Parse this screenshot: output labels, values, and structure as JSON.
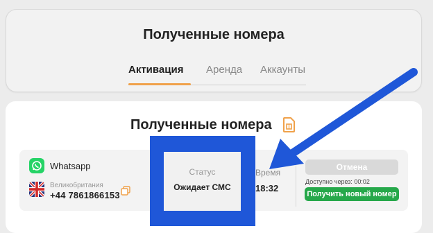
{
  "header": {
    "title": "Полученные номера",
    "tabs": [
      {
        "label": "Активация",
        "active": true
      },
      {
        "label": "Аренда",
        "active": false
      },
      {
        "label": "Аккаунты",
        "active": false
      }
    ]
  },
  "main": {
    "title": "Полученные номера",
    "row": {
      "service": "Whatsapp",
      "country": "Великобритания",
      "phone": "+44 7861866153",
      "status_label": "Статус",
      "status_value": "Ожидает СМС",
      "time_label": "Время",
      "time_value": "18:32",
      "cancel_label": "Отмена",
      "available_text": "Доступно через: 00:02",
      "new_number_label": "Получить новый номер"
    }
  },
  "colors": {
    "accent": "#f0a14a",
    "highlight": "#1f57d8",
    "whatsapp": "#25d366",
    "green_button": "#26a84a"
  },
  "icons": [
    "whatsapp-icon",
    "uk-flag-icon",
    "copy-icon",
    "sim-card-icon"
  ]
}
